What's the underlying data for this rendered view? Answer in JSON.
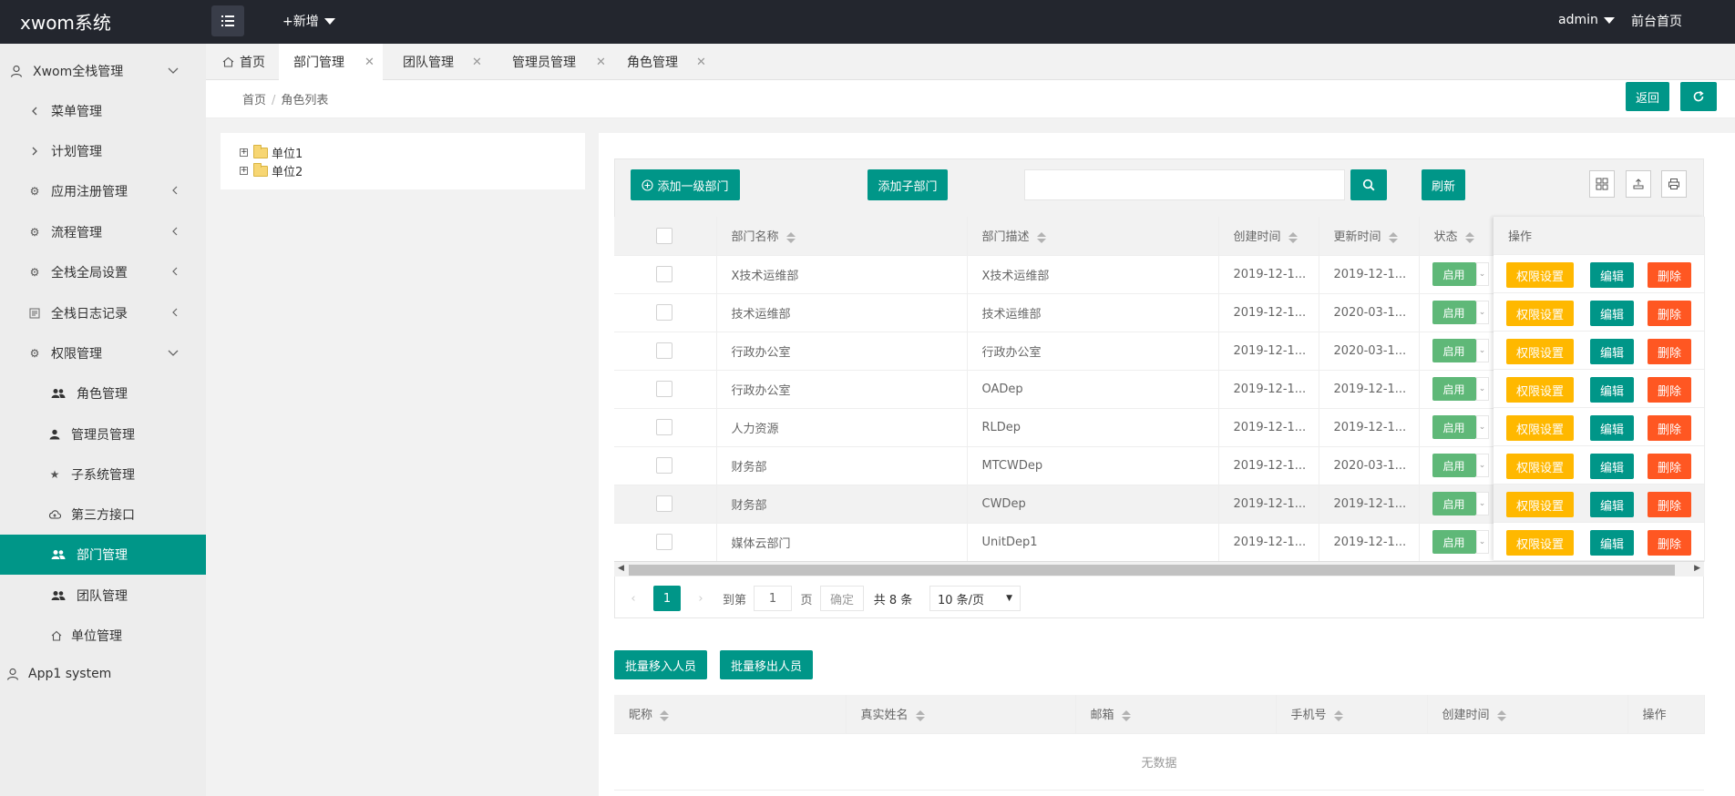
{
  "header": {
    "logo": "xwom系统",
    "new_label": "+新增",
    "user": "admin",
    "front_link": "前台首页"
  },
  "sidebar": {
    "items": [
      {
        "label": "Xwom全栈管理",
        "icon": "user-icon",
        "arrow": "chevron-down"
      },
      {
        "label": "菜单管理",
        "icon": "chevron-left-icon"
      },
      {
        "label": "计划管理",
        "icon": "chevron-right-icon"
      },
      {
        "label": "应用注册管理",
        "icon": "gear-icon",
        "arrow": "chevron-left"
      },
      {
        "label": "流程管理",
        "icon": "gear-icon",
        "arrow": "chevron-left"
      },
      {
        "label": "全栈全局设置",
        "icon": "gear-icon",
        "arrow": "chevron-left"
      },
      {
        "label": "全栈日志记录",
        "icon": "log-icon",
        "arrow": "chevron-left"
      },
      {
        "label": "权限管理",
        "icon": "gear-icon",
        "arrow": "chevron-down"
      },
      {
        "label": "角色管理",
        "icon": "users-icon"
      },
      {
        "label": "管理员管理",
        "icon": "user-solid-icon"
      },
      {
        "label": "子系统管理",
        "icon": "star-icon"
      },
      {
        "label": "第三方接口",
        "icon": "cloud-icon"
      },
      {
        "label": "部门管理",
        "icon": "users-icon"
      },
      {
        "label": "团队管理",
        "icon": "users-icon"
      },
      {
        "label": "单位管理",
        "icon": "home-icon"
      },
      {
        "label": "App1 system",
        "icon": "user-icon"
      }
    ]
  },
  "tabs": [
    {
      "label": "首页",
      "icon": "home-icon"
    },
    {
      "label": "部门管理"
    },
    {
      "label": "团队管理"
    },
    {
      "label": "管理员管理"
    },
    {
      "label": "角色管理"
    }
  ],
  "breadcrumb": {
    "home": "首页",
    "sep": "/",
    "current": "角色列表"
  },
  "actions": {
    "back": "返回"
  },
  "tree": [
    {
      "label": "单位1"
    },
    {
      "label": "单位2"
    }
  ],
  "toolbar": {
    "add_top": "添加一级部门",
    "add_child": "添加子部门",
    "refresh": "刷新"
  },
  "table": {
    "headers": [
      "部门名称",
      "部门描述",
      "创建时间",
      "更新时间",
      "状态",
      "操作"
    ],
    "status_label": "启用",
    "ops": [
      "权限设置",
      "编辑",
      "删除"
    ],
    "rows": [
      {
        "name": "X技术运维部",
        "desc": "X技术运维部",
        "created": "2019-12-1...",
        "updated": "2019-12-1..."
      },
      {
        "name": "技术运维部",
        "desc": "技术运维部",
        "created": "2019-12-1...",
        "updated": "2020-03-1..."
      },
      {
        "name": "行政办公室",
        "desc": "行政办公室",
        "created": "2019-12-1...",
        "updated": "2020-03-1..."
      },
      {
        "name": "行政办公室",
        "desc": "OADep",
        "created": "2019-12-1...",
        "updated": "2019-12-1..."
      },
      {
        "name": "人力资源",
        "desc": "RLDep",
        "created": "2019-12-1...",
        "updated": "2019-12-1..."
      },
      {
        "name": "财务部",
        "desc": "MTCWDep",
        "created": "2019-12-1...",
        "updated": "2020-03-1..."
      },
      {
        "name": "财务部",
        "desc": "CWDep",
        "created": "2019-12-1...",
        "updated": "2019-12-1..."
      },
      {
        "name": "媒体云部门",
        "desc": "UnitDep1",
        "created": "2019-12-1...",
        "updated": "2019-12-1..."
      }
    ]
  },
  "pager": {
    "current": "1",
    "goto": "到第",
    "page_input": "1",
    "page_unit": "页",
    "confirm": "确定",
    "total": "共 8 条",
    "per_page": "10 条/页"
  },
  "members": {
    "batch_in": "批量移入人员",
    "batch_out": "批量移出人员",
    "headers": [
      "昵称",
      "真实姓名",
      "邮箱",
      "手机号",
      "创建时间",
      "操作"
    ],
    "empty": "无数据"
  },
  "colors": {
    "primary": "#009688",
    "warn": "#ffb800",
    "danger": "#ff5722",
    "status": "#5fb878",
    "header": "#23262e"
  }
}
